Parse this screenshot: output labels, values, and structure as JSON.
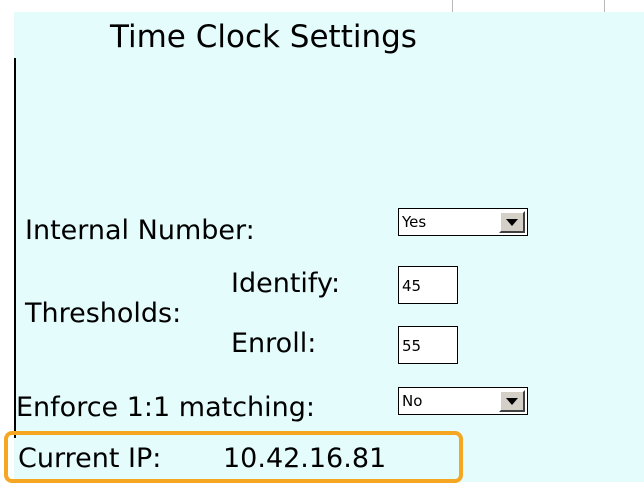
{
  "page": {
    "title": "Time Clock Settings"
  },
  "fields": {
    "internal_number": {
      "label": "Internal Number:",
      "value": "Yes"
    },
    "thresholds": {
      "label": "Thresholds:",
      "identify_label": "Identify:",
      "identify_value": "45",
      "enroll_label": "Enroll:",
      "enroll_value": "55"
    },
    "enforce_matching": {
      "label": "Enforce 1:1 matching:",
      "value": "No"
    },
    "current_ip": {
      "label": "Current IP:",
      "value": "10.42.16.81"
    }
  },
  "colors": {
    "panel_background": "#e4fcfc",
    "highlight_border": "#f5a623"
  },
  "icons": {
    "dropdown": "chevron-down-icon"
  }
}
